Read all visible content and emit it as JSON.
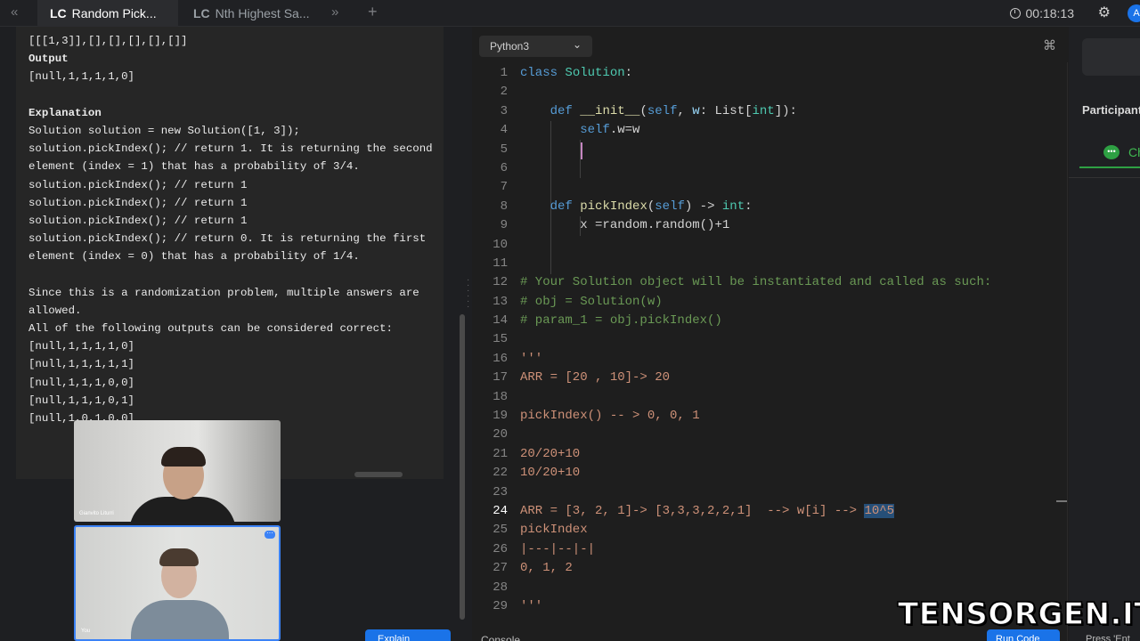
{
  "tabs": [
    {
      "prefix": "LC",
      "label": "Random Pick..."
    },
    {
      "prefix": "LC",
      "label": "Nth Highest Sa..."
    }
  ],
  "timer": "00:18:13",
  "avatar_initial": "A",
  "description": {
    "lines": [
      "[[[1,3]],[],[],[],[],[]]",
      "Output",
      "[null,1,1,1,1,0]",
      "",
      "Explanation",
      "Solution solution = new Solution([1, 3]);",
      "solution.pickIndex(); // return 1. It is returning the second",
      "element (index = 1) that has a probability of 3/4.",
      "solution.pickIndex(); // return 1",
      "solution.pickIndex(); // return 1",
      "solution.pickIndex(); // return 1",
      "solution.pickIndex(); // return 0. It is returning the first",
      "element (index = 0) that has a probability of 1/4.",
      "",
      "Since this is a randomization problem, multiple answers are",
      "allowed.",
      "All of the following outputs can be considered correct:",
      "[null,1,1,1,1,0]",
      "[null,1,1,1,1,1]",
      "[null,1,1,1,0,0]",
      "[null,1,1,1,0,1]",
      "[null,1,0,1,0,0]"
    ]
  },
  "videos": [
    {
      "name": "Gianvito Liturri"
    },
    {
      "name": "You"
    }
  ],
  "editor": {
    "language": "Python3",
    "line_numbers": [
      "1",
      "2",
      "3",
      "4",
      "5",
      "6",
      "7",
      "8",
      "9",
      "10",
      "11",
      "12",
      "13",
      "14",
      "15",
      "16",
      "17",
      "18",
      "19",
      "20",
      "21",
      "22",
      "23",
      "24",
      "25",
      "26",
      "27",
      "28",
      "29"
    ],
    "code": {
      "l1_kw": "class",
      "l1_name": "Solution",
      "l1_rest": ":",
      "l3_kw": "def",
      "l3_fn": "__init__",
      "l3_open": "(",
      "l3_self": "self",
      "l3_sep": ", ",
      "l3_param": "w",
      "l3_colon": ": List[",
      "l3_type": "int",
      "l3_close": "]):",
      "l4_self": "self",
      "l4_rest": ".w=w",
      "l8_kw": "def",
      "l8_fn": "pickIndex",
      "l8_open": "(",
      "l8_self": "self",
      "l8_mid": ") -> ",
      "l8_type": "int",
      "l8_end": ":",
      "l9": "x =random.random()+1",
      "l12": "# Your Solution object will be instantiated and called as such:",
      "l13": "# obj = Solution(w)",
      "l14": "# param_1 = obj.pickIndex()",
      "l16": "'''",
      "l17": "ARR = [20 , 10]-> 20",
      "l19": "pickIndex() -- > 0, 0, 1",
      "l21": "20/20+10",
      "l22": "10/20+10",
      "l24_a": "ARR = [3, 2, 1]-> [3,3,3,2,2,1]  --> w[i] --> ",
      "l24_sel": "10^5",
      "l25": "pickIndex",
      "l26": "|---|--|-|",
      "l27": "0, 1, 2",
      "l29": "'''"
    }
  },
  "right_panel": {
    "title": "Participant",
    "tab": "Ch"
  },
  "bottom": {
    "explain": "Explain",
    "console": "Console",
    "run": "Run Code",
    "press": "Press 'Ent"
  },
  "watermark": "TENSORGEN.IT",
  "icons": [
    "double-chevron-left-icon",
    "double-chevron-right-icon",
    "plus-icon",
    "clock-icon",
    "gear-icon",
    "chevron-down-icon",
    "command-icon",
    "chat-icon",
    "more-icon"
  ],
  "colors": {
    "accent": "#1a73e8",
    "green": "#2ea043",
    "keyword": "#569cd6",
    "comment": "#6a9955",
    "string": "#ce9178"
  }
}
